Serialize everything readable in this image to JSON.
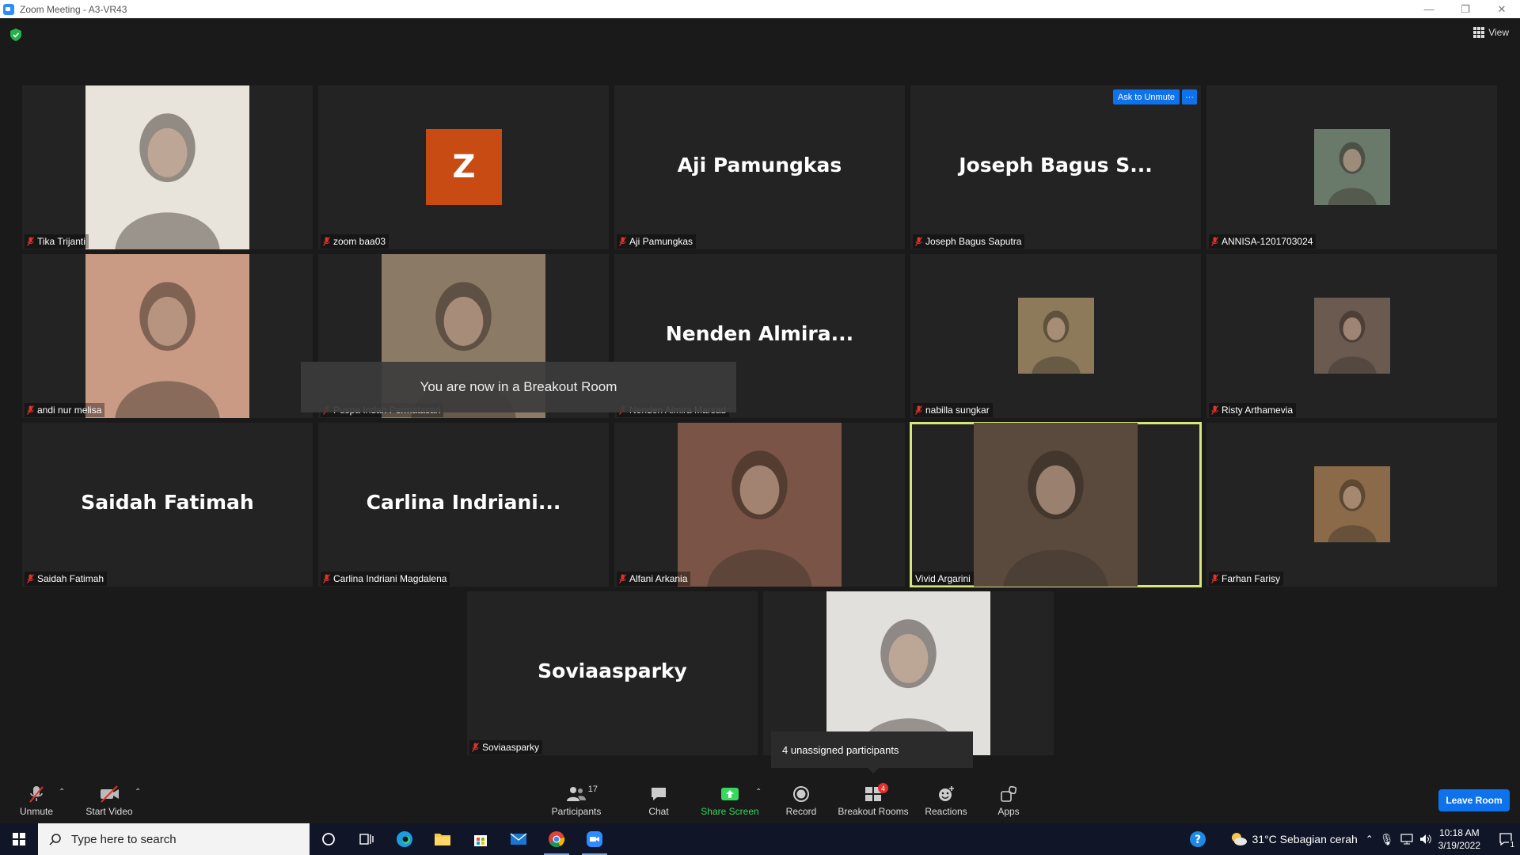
{
  "window": {
    "title": "Zoom Meeting - A3-VR43",
    "minimize": "—",
    "restore": "❐",
    "close": "✕"
  },
  "view_label": "View",
  "tiles": [
    {
      "label": "Tika Trijanti",
      "kind": "photo",
      "bg": "#e9e4db"
    },
    {
      "label": "zoom baa03",
      "kind": "letter",
      "letter": "Z"
    },
    {
      "label": "Aji Pamungkas",
      "kind": "name",
      "big": "Aji Pamungkas"
    },
    {
      "label": "Joseph Bagus Saputra",
      "kind": "name",
      "big": "Joseph Bagus S..."
    },
    {
      "label": "ANNISA-1201703024",
      "kind": "photo-small",
      "bg": "#6a7a6a"
    },
    {
      "label": "andi nur melisa",
      "kind": "photo",
      "bg": "#c99a84"
    },
    {
      "label": "Puspa Indah Permatasari",
      "kind": "photo",
      "bg": "#8a7a66"
    },
    {
      "label": "Nenden Almira Marsad",
      "kind": "name",
      "big": "Nenden Almira..."
    },
    {
      "label": "nabilla sungkar",
      "kind": "photo-small",
      "bg": "#8c7a5a"
    },
    {
      "label": "Risty Arthamevia",
      "kind": "photo-small",
      "bg": "#6a5a50"
    },
    {
      "label": "Saidah Fatimah",
      "kind": "name",
      "big": "Saidah Fatimah"
    },
    {
      "label": "Carlina Indriani Magdalena",
      "kind": "name",
      "big": "Carlina Indriani..."
    },
    {
      "label": "Alfani Arkania",
      "kind": "photo",
      "bg": "#7a5446"
    },
    {
      "label": "Vivid Argarini",
      "kind": "photo",
      "bg": "#5a4a3e"
    },
    {
      "label": "Farhan Farisy",
      "kind": "photo-small",
      "bg": "#8a6a48"
    },
    {
      "label": "Soviaasparky",
      "kind": "name",
      "big": "Soviaasparky"
    },
    {
      "label": "",
      "kind": "photo",
      "bg": "#e2e0dc"
    }
  ],
  "ask_to_unmute": "Ask to Unmute",
  "more": "···",
  "toast": "You are now in a Breakout Room",
  "tooltip": "4 unassigned participants",
  "toolbar": {
    "unmute": "Unmute",
    "start_video": "Start Video",
    "participants": "Participants",
    "participants_count": "17",
    "chat": "Chat",
    "share_screen": "Share Screen",
    "record": "Record",
    "breakout_rooms": "Breakout Rooms",
    "breakout_badge": "4",
    "reactions": "Reactions",
    "apps": "Apps",
    "leave": "Leave Room"
  },
  "taskbar": {
    "search_placeholder": "Type here to search",
    "weather": "31°C  Sebagian cerah",
    "time": "10:18 AM",
    "date": "3/19/2022",
    "notifications": "1"
  },
  "colors": {
    "accent": "#0e72ed",
    "share_green": "#37d85c",
    "active_speaker": "#d7e57a",
    "avatar": "#c74b13"
  }
}
